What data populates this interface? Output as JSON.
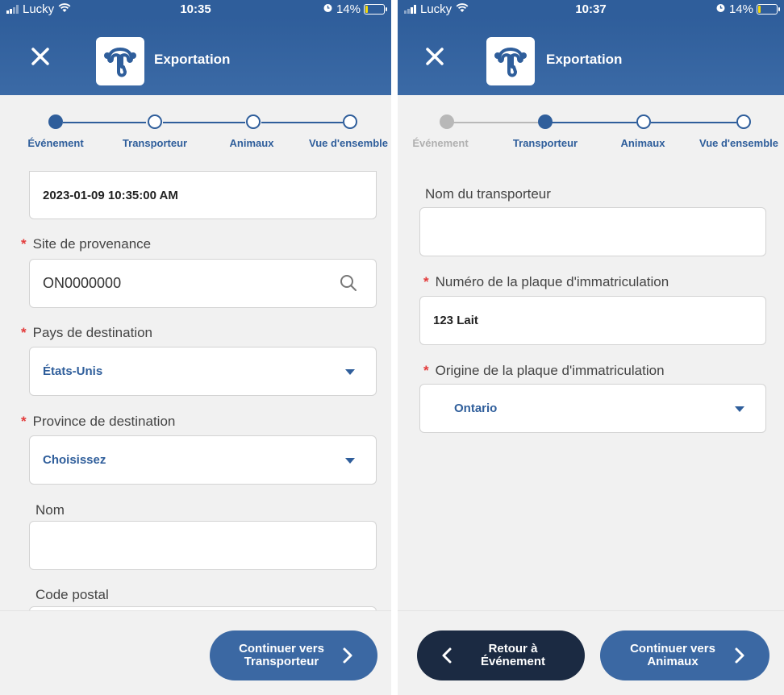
{
  "colors": {
    "brand": "#2f5e9b",
    "active_step": "#2f5e9b",
    "completed_step": "#b8b8b8",
    "required": "#e33b3b",
    "primary_button": "#3b68a3",
    "dark_button": "#1b2a42",
    "battery": "#f5d90a"
  },
  "screens": [
    {
      "status": {
        "carrier": "Lucky",
        "time": "10:35",
        "battery": "14%",
        "battery_level": 0.14
      },
      "header": {
        "title": "Exportation",
        "close_icon": "close-icon",
        "logo_icon": "uterus-logo-icon"
      },
      "steps": [
        {
          "label": "Événement",
          "state": "active"
        },
        {
          "label": "Transporteur",
          "state": "upcoming"
        },
        {
          "label": "Animaux",
          "state": "upcoming"
        },
        {
          "label": "Vue d'ensemble",
          "state": "upcoming"
        }
      ],
      "fields": {
        "datetime_value": "2023-01-09 10:35:00 AM",
        "site_label": "Site de provenance",
        "site_value": "ON0000000",
        "pays_label": "Pays de destination",
        "pays_value": "États-Unis",
        "province_label": "Province de destination",
        "province_value": "Choisissez",
        "nom_label": "Nom",
        "nom_value": "",
        "code_postal_label": "Code postal",
        "required_mark": "*"
      },
      "footer": {
        "next_label": "Continuer vers\nTransporteur"
      }
    },
    {
      "status": {
        "carrier": "Lucky",
        "time": "10:37",
        "battery": "14%",
        "battery_level": 0.14
      },
      "header": {
        "title": "Exportation",
        "close_icon": "close-icon",
        "logo_icon": "uterus-logo-icon"
      },
      "steps": [
        {
          "label": "Événement",
          "state": "done"
        },
        {
          "label": "Transporteur",
          "state": "active"
        },
        {
          "label": "Animaux",
          "state": "upcoming"
        },
        {
          "label": "Vue d'ensemble",
          "state": "upcoming"
        }
      ],
      "fields": {
        "transporteur_label": "Nom du transporteur",
        "transporteur_value": "",
        "plaque_label": "Numéro de la plaque d'immatriculation",
        "plaque_value": "123 Lait",
        "origine_label": "Origine de la plaque d'immatriculation",
        "origine_value": "Ontario",
        "required_mark": "*"
      },
      "footer": {
        "back_label": "Retour à\nÉvénement",
        "next_label": "Continuer vers\nAnimaux"
      }
    }
  ]
}
